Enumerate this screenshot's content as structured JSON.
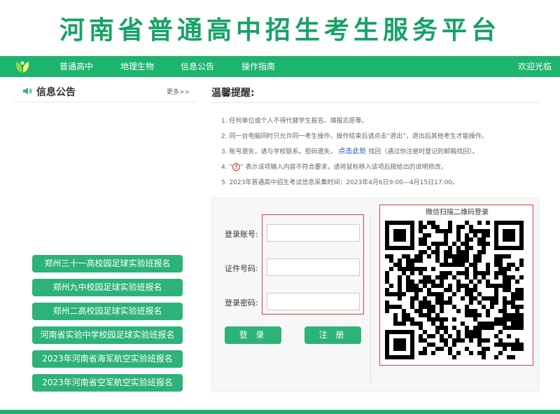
{
  "header": {
    "title": "河南省普通高中招生考生服务平台"
  },
  "nav": {
    "items": [
      "普通高中",
      "地理生物",
      "信息公告",
      "操作指南"
    ],
    "welcome": "欢迎光临"
  },
  "info": {
    "title": "信息公告",
    "more": "更多>>",
    "buttons": [
      "郑州三十一高校园足球实验班报名",
      "郑州九中校园足球实验班报名",
      "郑州二高校园足球实验班报名",
      "河南省实验中学校园足球实验班报名",
      "2023年河南省海军航空实验班报名",
      "2023年河南省空军航空实验班报名"
    ]
  },
  "tips": {
    "title": "温馨提醒:",
    "line1": "1. 任何单位或个人不得代替学生报名、填报志愿等。",
    "line2": "2. 同一台电脑同时只允许同一考生操作，操作结束后请点击“退出”，退出后其他考生才能操作。",
    "line3_pre": "3. 账号遗失，请与学校联系。密码遗失，",
    "line3_link": "点击此处",
    "line3_post": "找回（通过你注册时登记的邮箱找回）。",
    "line4_pre": "4. “",
    "line4_icon": "!",
    "line4_post": "” 表示该项输入内容不符合要求，请将鼠标移入该项后按给出的说明修改。",
    "line5": "5. 2023年普通高中招生考试信息采集时间：2023年4月6日9:00—4月15日17:00。"
  },
  "login": {
    "account_label": "登录账号:",
    "id_label": "证件号码:",
    "password_label": "登录密码:",
    "account_value": "",
    "id_value": "",
    "password_value": "",
    "login_button": "登 录",
    "register_button": "注 册"
  },
  "qr": {
    "caption": "微信扫描二维码登录"
  },
  "colors": {
    "brand_green": "#1db46f",
    "button_green": "#2db27a",
    "title_green": "#16a266",
    "alert_red": "#d94040"
  }
}
